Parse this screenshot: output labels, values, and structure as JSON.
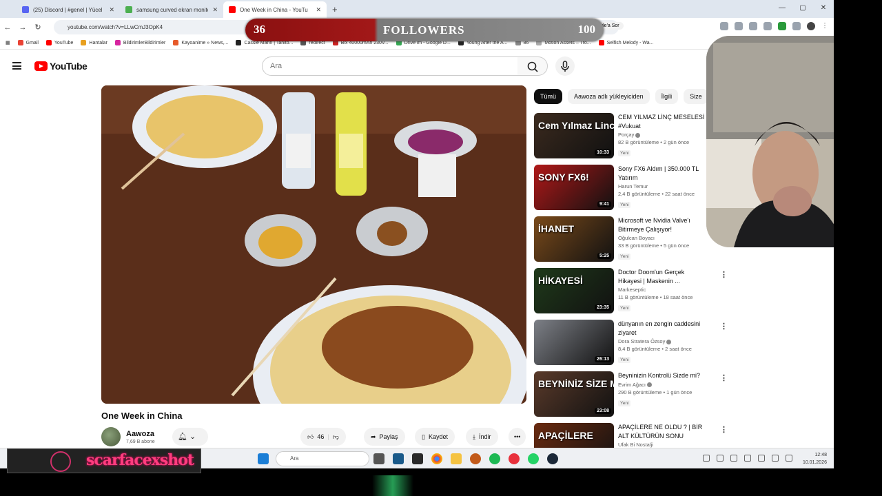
{
  "browser": {
    "tabs": [
      {
        "title": "(25) Discord | #genel | Yücel",
        "active": false,
        "color": "#5865f2"
      },
      {
        "title": "samsung curved ekran monitö",
        "active": false,
        "color": "#4caf50"
      },
      {
        "title": "One Week in China - YouTu",
        "active": true,
        "color": "#ff0000"
      }
    ],
    "url": "youtube.com/watch?v=LLwCmJ3OpK4",
    "google_sor": "Google'a Sor",
    "bookmarks": [
      "Gmail",
      "YouTube",
      "Hantalar",
      "BildirimlerBildirimler",
      "Kayoanime » News,...",
      "Cassie Marin | Tanito...",
      "redirect",
      "Bix 40000mAh 230V...",
      "Drive'ım - Google D...",
      "Young After the A...",
      "86",
      "Motion Assets – Tro...",
      "Selfish Melody - Wa..."
    ]
  },
  "overlay": {
    "left": "36",
    "middle": "FOLLOWERS",
    "right": "100"
  },
  "youtube": {
    "logo": "YouTube",
    "search_placeholder": "Ara",
    "video": {
      "title": "One Week in China"
    },
    "channel": {
      "name": "Aawoza",
      "subs": "7,69 B abone"
    },
    "actions": {
      "likes": "46",
      "share": "Paylaş",
      "save": "Kaydet",
      "download": "İndir"
    },
    "chips": [
      "Tümü",
      "Aawoza adlı yükleyiciden",
      "İlgili",
      "Size"
    ],
    "recommendations": [
      {
        "title": "CEM YILMAZ LİNÇ MESELESİ #Vukuat",
        "channel": "Porçay",
        "verified": true,
        "views": "82 B görüntüleme • 2 gün önce",
        "badge": "Yeni",
        "duration": "10:33",
        "thumb_text": "Cem Yılmaz Linci",
        "thumb_color": "#3b2a1e"
      },
      {
        "title": "Sony FX6 Aldım | 350.000 TL Yatırım",
        "channel": "Harun Temur",
        "verified": false,
        "views": "2,4 B görüntüleme • 22 saat önce",
        "badge": "Yeni",
        "duration": "9:41",
        "thumb_text": "SONY FX6!",
        "thumb_color": "#b01818"
      },
      {
        "title": "Microsoft ve Nvidia Valve'ı Bitirmeye Çalışıyor!",
        "channel": "Oğulcan Boyacı",
        "verified": false,
        "views": "33 B görüntüleme • 5 gün önce",
        "badge": "Yeni",
        "duration": "5:25",
        "thumb_text": "İHANET",
        "thumb_color": "#7a4a1a"
      },
      {
        "title": "Doctor Doom'un Gerçek Hikayesi | Maskenin ...",
        "channel": "Markeseptic",
        "verified": false,
        "views": "11 B görüntüleme • 18 saat önce",
        "badge": "Yeni",
        "duration": "23:35",
        "thumb_text": "HİKAYESİ",
        "thumb_color": "#1f3a1a"
      },
      {
        "title": "dünyanın en zengin caddesini ziyaret",
        "channel": "Dora Stratera Özsoy",
        "verified": true,
        "views": "8,4 B görüntüleme • 2 saat önce",
        "badge": "Yeni",
        "duration": "26:13",
        "thumb_text": "",
        "thumb_color": "#7d8087"
      },
      {
        "title": "Beyninizin Kontrolü Sizde mi?",
        "channel": "Evrim Ağacı",
        "verified": true,
        "views": "290 B görüntüleme • 1 gün önce",
        "badge": "Yeni",
        "duration": "23:08",
        "thumb_text": "BEYNİNİZ SİZE Mİ",
        "thumb_color": "#5a3a2a"
      },
      {
        "title": "APAÇİLERE NE OLDU ? | BİR ALT KÜLTÜRÜN SONU",
        "channel": "Ufak Bi Nostalji",
        "verified": false,
        "views": "",
        "badge": "",
        "duration": "",
        "thumb_text": "APAÇİLERE",
        "thumb_color": "#6a2a10"
      }
    ]
  },
  "taskbar": {
    "search": "Ara",
    "time": "12:48",
    "date": "10.01.2026"
  },
  "banner": {
    "handle": "scarfacexshot"
  }
}
